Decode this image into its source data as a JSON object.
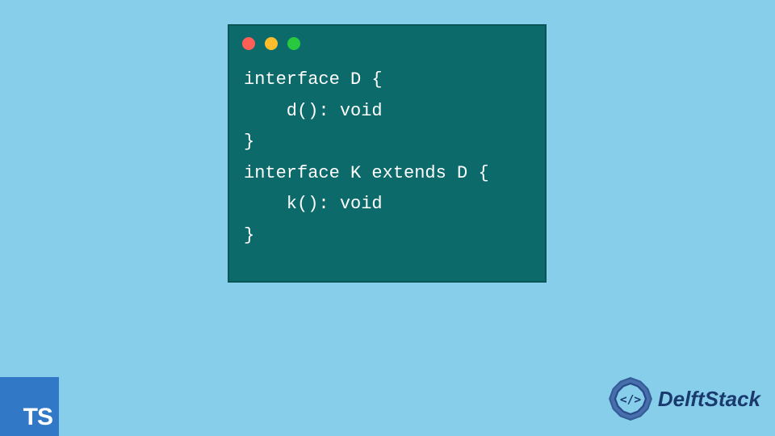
{
  "code_window": {
    "controls": [
      "red",
      "yellow",
      "green"
    ],
    "code_lines": [
      "interface D {",
      "    d(): void",
      "}",
      "interface K extends D {",
      "    k(): void",
      "}"
    ]
  },
  "ts_badge": {
    "label": "TS"
  },
  "delft_logo": {
    "text": "DelftStack",
    "icon_name": "delftstack-gear-icon",
    "icon_color": "#2a4a8a"
  },
  "colors": {
    "background": "#87ceeb",
    "code_bg": "#0d6a6a",
    "ts_blue": "#3178c6"
  }
}
